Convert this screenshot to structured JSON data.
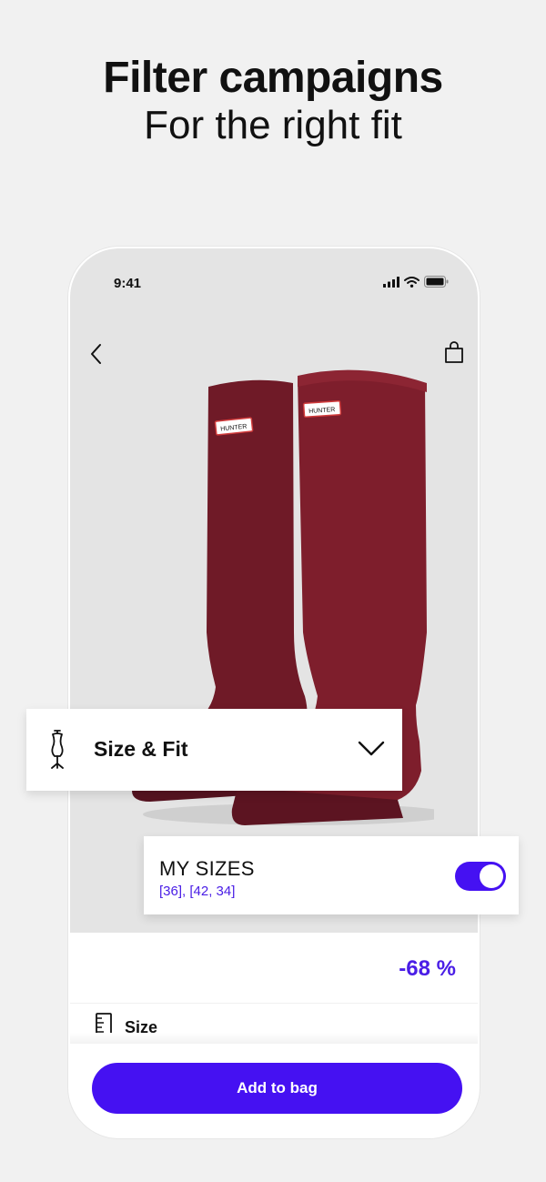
{
  "headline": "Filter campaigns",
  "subline": "For the right fit",
  "status_bar": {
    "time": "9:41"
  },
  "product": {
    "brand_tag": "HUNTER",
    "discount": "-68 %",
    "size_label": "Size",
    "boot_color": "#7e1e2c"
  },
  "size_fit_card": {
    "title": "Size & Fit"
  },
  "my_sizes_card": {
    "title": "MY SIZES",
    "values": "[36], [42, 34]",
    "toggle_on": true
  },
  "cta": {
    "add_to_bag": "Add to bag"
  },
  "colors": {
    "accent": "#4511f2",
    "accent_text": "#4a1ee6",
    "background": "#f1f1f1"
  },
  "icons": [
    "back-chevron-icon",
    "shopping-bag-icon",
    "dress-form-icon",
    "chevron-down-icon",
    "ruler-icon",
    "signal-icon",
    "wifi-icon",
    "battery-icon"
  ]
}
